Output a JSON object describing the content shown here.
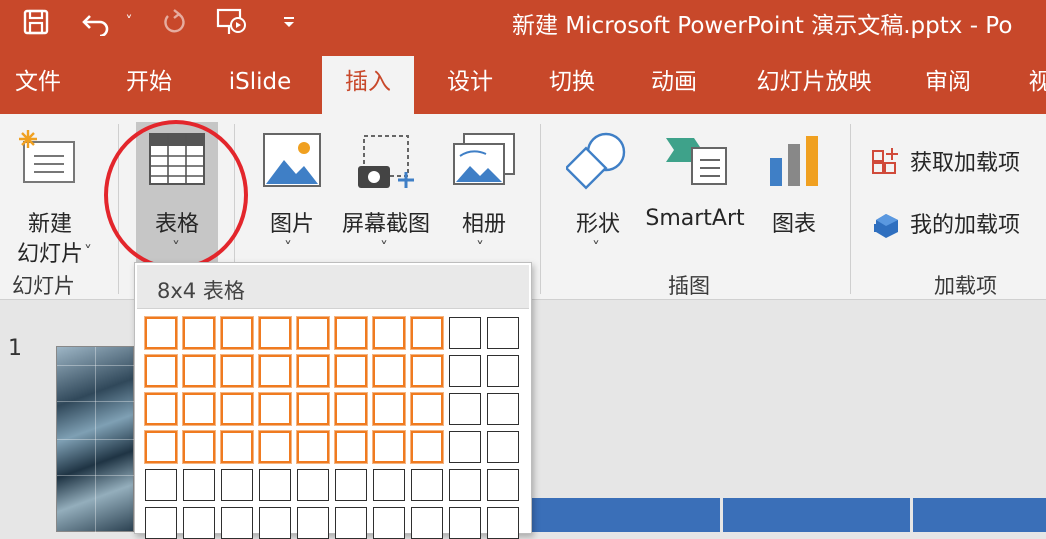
{
  "window": {
    "title": "新建 Microsoft PowerPoint 演示文稿.pptx  -  Po"
  },
  "qat": {
    "save": "save-icon",
    "undo": "undo-icon",
    "undo_dropdown": "˅",
    "redo": "redo-icon",
    "present": "present-from-start-icon",
    "customize": "customize-qat-icon"
  },
  "tabs": [
    {
      "label": "文件"
    },
    {
      "label": "开始"
    },
    {
      "label": "iSlide"
    },
    {
      "label": "插入",
      "active": true
    },
    {
      "label": "设计"
    },
    {
      "label": "切换"
    },
    {
      "label": "动画"
    },
    {
      "label": "幻灯片放映"
    },
    {
      "label": "审阅"
    },
    {
      "label": "视"
    }
  ],
  "ribbon": {
    "new_slide": {
      "line1": "新建",
      "line2": "幻灯片",
      "chevron": "˅"
    },
    "table": {
      "label": "表格",
      "chevron": "˅"
    },
    "picture": {
      "label": "图片",
      "chevron": "˅"
    },
    "screenshot": {
      "label": "屏幕截图",
      "chevron": "˅"
    },
    "album": {
      "label": "相册",
      "chevron": "˅"
    },
    "shapes": {
      "label": "形状",
      "chevron": "˅"
    },
    "smartart": {
      "label": "SmartArt"
    },
    "chart": {
      "label": "图表"
    },
    "get_addins": {
      "label": "获取加载项"
    },
    "my_addins": {
      "label": "我的加载项"
    },
    "groups": {
      "slides": "幻灯片",
      "illustrations": "插图",
      "addins": "加载项"
    }
  },
  "table_picker": {
    "title": "8x4 表格",
    "selected_cols": 8,
    "selected_rows": 4,
    "grid_cols": 10,
    "grid_rows_visible": 6
  },
  "slides_panel": {
    "slide_number": "1"
  },
  "colors": {
    "brand": "#c8482a",
    "selection": "#f07b20",
    "highlight_circle": "#e3262c",
    "canvas_blue": "#3a6fb8"
  }
}
